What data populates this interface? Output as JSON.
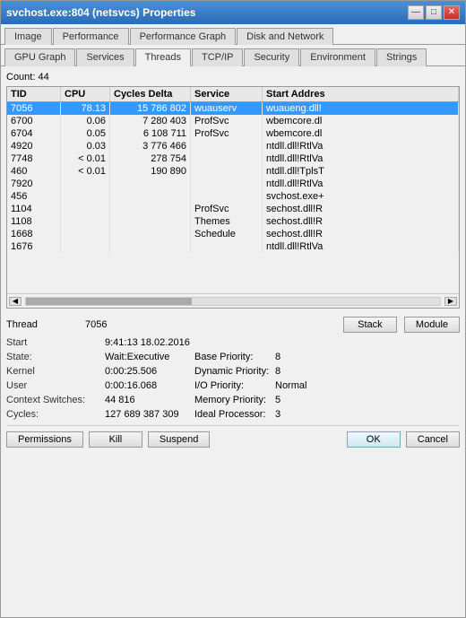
{
  "window": {
    "title": "svchost.exe:804 (netsvcs) Properties",
    "min_label": "—",
    "max_label": "□",
    "close_label": "✕"
  },
  "tabs_row1": [
    {
      "label": "Image",
      "active": false
    },
    {
      "label": "Performance",
      "active": false
    },
    {
      "label": "Performance Graph",
      "active": false
    },
    {
      "label": "Disk and Network",
      "active": false
    }
  ],
  "tabs_row2": [
    {
      "label": "GPU Graph",
      "active": false
    },
    {
      "label": "Services",
      "active": false
    },
    {
      "label": "Threads",
      "active": true
    },
    {
      "label": "TCP/IP",
      "active": false
    },
    {
      "label": "Security",
      "active": false
    },
    {
      "label": "Environment",
      "active": false
    },
    {
      "label": "Strings",
      "active": false
    }
  ],
  "count_label": "Count:",
  "count_value": "44",
  "table": {
    "headers": [
      "TID",
      "CPU",
      "Cycles Delta",
      "Service",
      "Start Addres"
    ],
    "rows": [
      {
        "tid": "7056",
        "cpu": "78.13",
        "cycles": "15 786 802",
        "service": "wuauserv",
        "start": "wuaueng.dll!",
        "selected": true
      },
      {
        "tid": "6700",
        "cpu": "0.06",
        "cycles": "7 280 403",
        "service": "ProfSvc",
        "start": "wbemcore.dl",
        "selected": false
      },
      {
        "tid": "6704",
        "cpu": "0.05",
        "cycles": "6 108 711",
        "service": "ProfSvc",
        "start": "wbemcore.dl",
        "selected": false
      },
      {
        "tid": "4920",
        "cpu": "0.03",
        "cycles": "3 776 466",
        "service": "",
        "start": "ntdll.dll!RtlVa",
        "selected": false
      },
      {
        "tid": "7748",
        "cpu": "< 0.01",
        "cycles": "278 754",
        "service": "",
        "start": "ntdll.dll!RtlVa",
        "selected": false
      },
      {
        "tid": "460",
        "cpu": "< 0.01",
        "cycles": "190 890",
        "service": "",
        "start": "ntdll.dll!TplsT",
        "selected": false
      },
      {
        "tid": "7920",
        "cpu": "",
        "cycles": "",
        "service": "",
        "start": "ntdll.dll!RtlVa",
        "selected": false
      },
      {
        "tid": "456",
        "cpu": "",
        "cycles": "",
        "service": "",
        "start": "svchost.exe+",
        "selected": false
      },
      {
        "tid": "1104",
        "cpu": "",
        "cycles": "",
        "service": "ProfSvc",
        "start": "sechost.dll!R",
        "selected": false
      },
      {
        "tid": "1108",
        "cpu": "",
        "cycles": "",
        "service": "Themes",
        "start": "sechost.dll!R",
        "selected": false
      },
      {
        "tid": "1668",
        "cpu": "",
        "cycles": "",
        "service": "Schedule",
        "start": "sechost.dll!R",
        "selected": false
      },
      {
        "tid": "1676",
        "cpu": "",
        "cycles": "",
        "service": "",
        "start": "ntdll.dll!RtlVa",
        "selected": false
      }
    ]
  },
  "thread_detail": {
    "thread_label": "Thread",
    "thread_value": "7056",
    "start_label": "Start",
    "start_value": "9:41:13   18.02.2016",
    "state_label": "State:",
    "state_value": "Wait:Executive",
    "base_priority_label": "Base Priority:",
    "base_priority_value": "8",
    "kernel_label": "Kernel",
    "kernel_value": "0:00:25.506",
    "dynamic_priority_label": "Dynamic Priority:",
    "dynamic_priority_value": "8",
    "user_label": "User",
    "user_value": "0:00:16.068",
    "io_priority_label": "I/O Priority:",
    "io_priority_value": "Normal",
    "context_switches_label": "Context Switches:",
    "context_switches_value": "44 816",
    "memory_priority_label": "Memory Priority:",
    "memory_priority_value": "5",
    "cycles_label": "Cycles:",
    "cycles_value": "127 689 387 309",
    "ideal_processor_label": "Ideal Processor:",
    "ideal_processor_value": "3"
  },
  "buttons": {
    "stack": "Stack",
    "module": "Module",
    "permissions": "Permissions",
    "kill": "Kill",
    "suspend": "Suspend",
    "ok": "OK",
    "cancel": "Cancel"
  }
}
